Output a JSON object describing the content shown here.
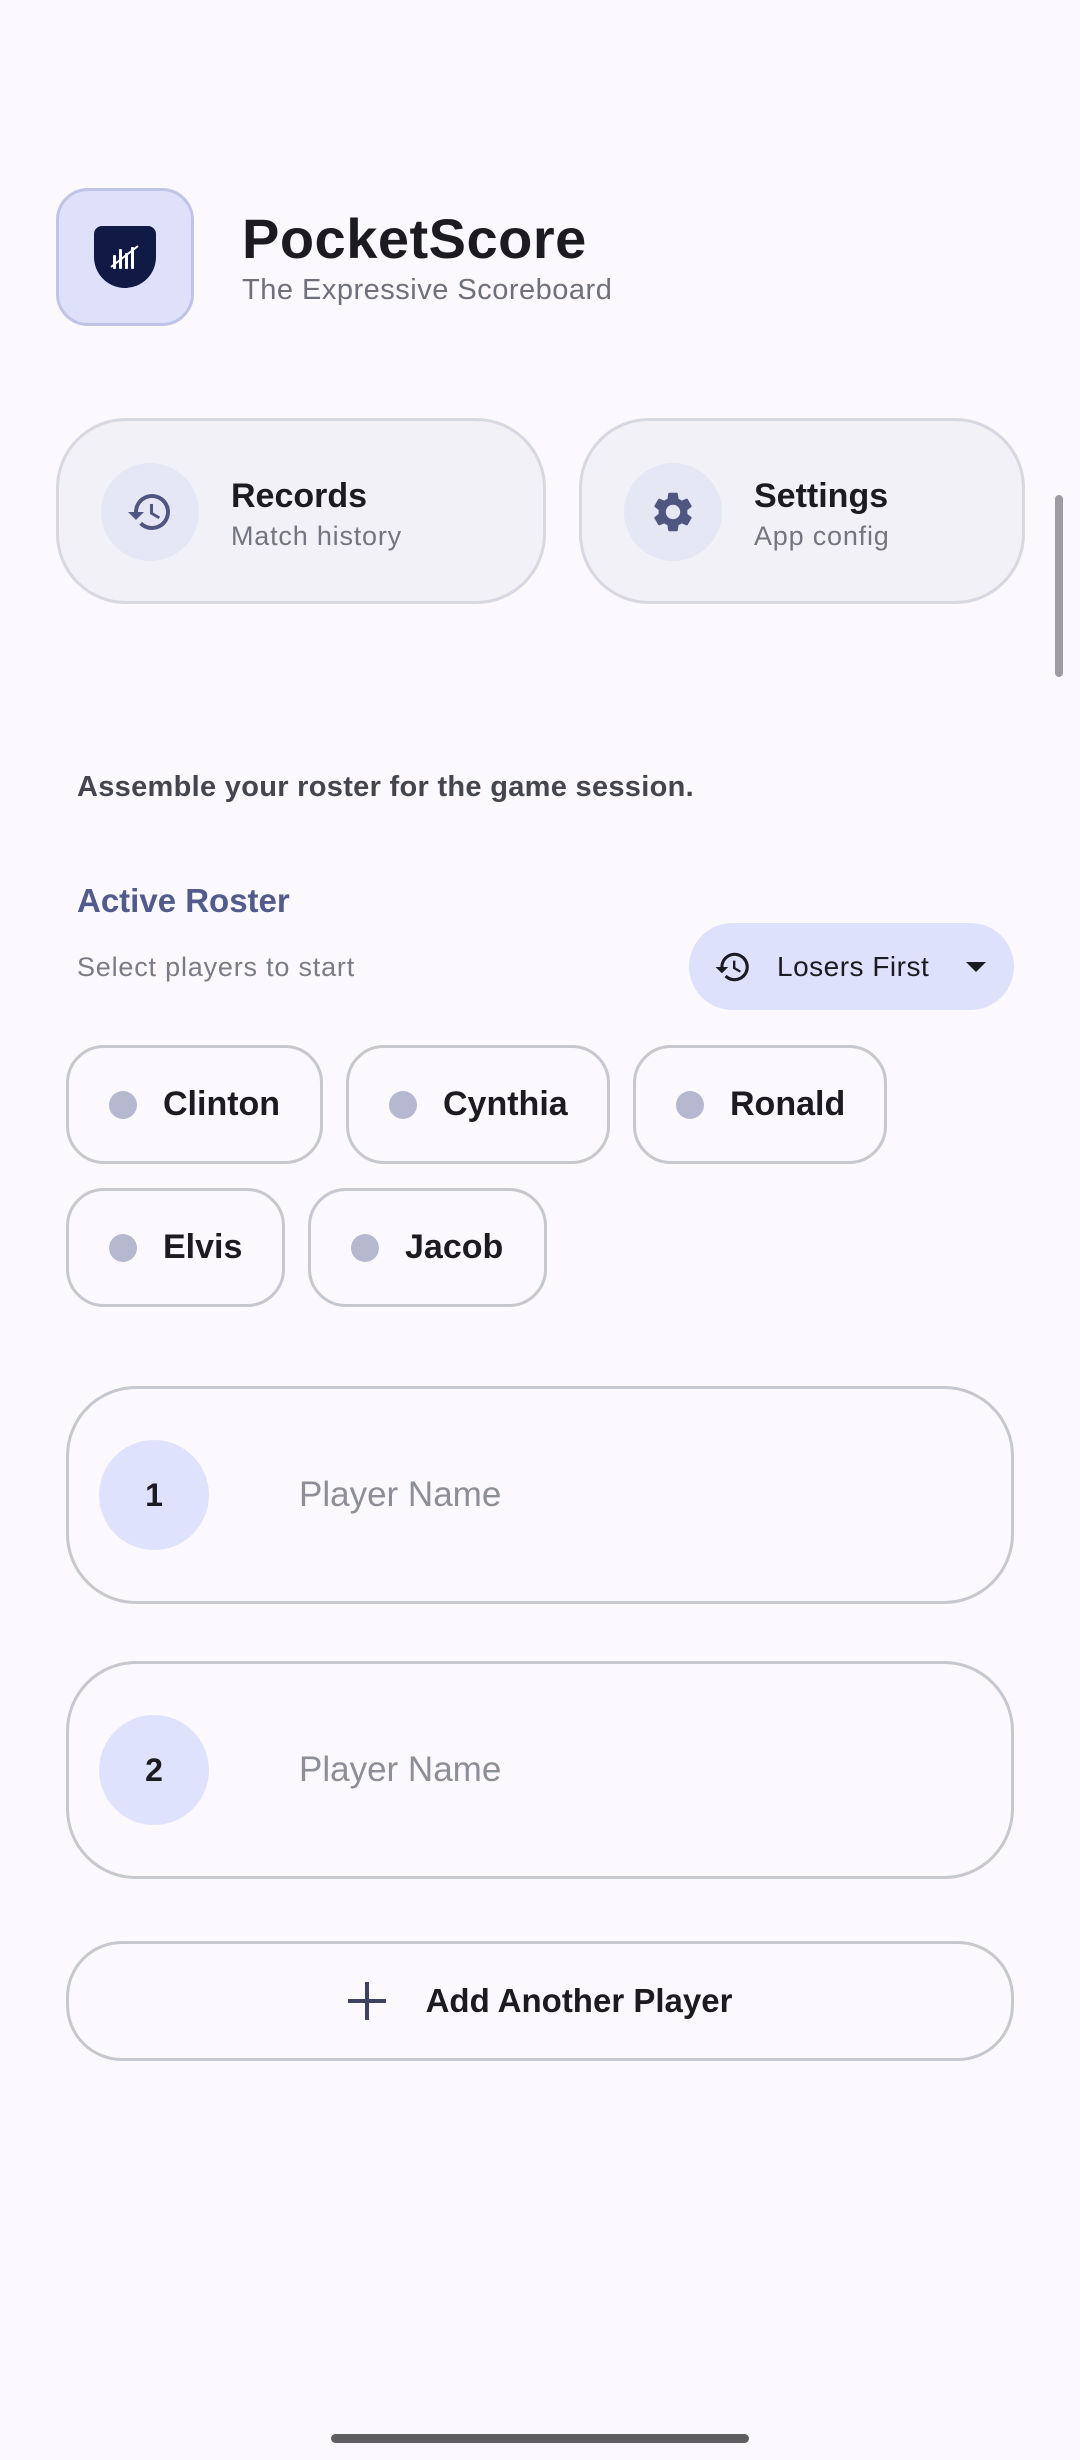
{
  "app": {
    "title": "PocketScore",
    "subtitle": "The Expressive Scoreboard",
    "icon": "scoreboard-shield-icon"
  },
  "nav": {
    "records": {
      "label": "Records",
      "sub": "Match history",
      "icon": "history-icon"
    },
    "settings": {
      "label": "Settings",
      "sub": "App config",
      "icon": "gear-icon"
    }
  },
  "instructions": "Assemble your roster for the game session.",
  "roster": {
    "title": "Active Roster",
    "subtitle": "Select players to start",
    "sort": {
      "label": "Losers First",
      "icon": "history-icon"
    },
    "chips": [
      "Clinton",
      "Cynthia",
      "Ronald",
      "Elvis",
      "Jacob"
    ]
  },
  "players": [
    {
      "number": "1",
      "placeholder": "Player Name",
      "value": ""
    },
    {
      "number": "2",
      "placeholder": "Player Name",
      "value": ""
    }
  ],
  "add_player_label": "Add Another Player",
  "colors": {
    "background": "#fbf8fe",
    "accent": "#dde1fc",
    "primary_dark": "#111a44",
    "roster_title": "#515b8c"
  }
}
